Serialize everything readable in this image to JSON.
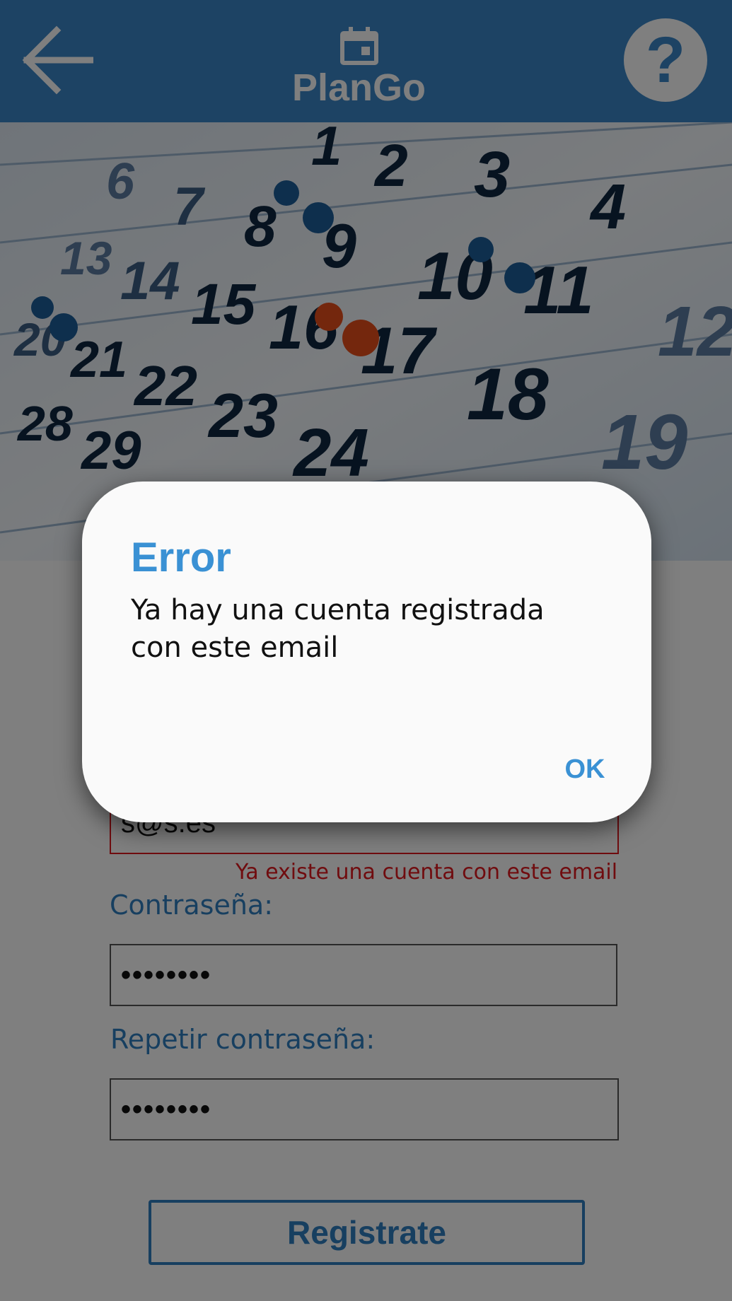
{
  "app_bar": {
    "title": "PlanGo",
    "back_icon": "arrow-left-icon",
    "calendar_icon": "calendar-icon",
    "help_icon": "help-icon",
    "help_glyph": "?",
    "color": "#3a87c8"
  },
  "hero": {
    "description_icon": "calendar-photo",
    "day_numbers": [
      "1",
      "2",
      "3",
      "4",
      "6",
      "7",
      "8",
      "9",
      "10",
      "11",
      "12",
      "13",
      "14",
      "15",
      "16",
      "17",
      "18",
      "19",
      "20",
      "21",
      "22",
      "23",
      "24",
      "28",
      "29"
    ]
  },
  "form": {
    "email_value": "s@s.es",
    "email_error": "Ya existe una cuenta con este email",
    "password_label": "Contraseña:",
    "password_value": "••••••••",
    "repeat_password_label": "Repetir contraseña:",
    "repeat_password_value": "••••••••",
    "register_button": "Registrate"
  },
  "dialog": {
    "title": "Error",
    "message": "Ya hay una cuenta registrada con este email",
    "ok_label": "OK"
  },
  "colors": {
    "primary": "#3a87c8",
    "accent": "#3a91d4",
    "error": "#e0191f"
  }
}
